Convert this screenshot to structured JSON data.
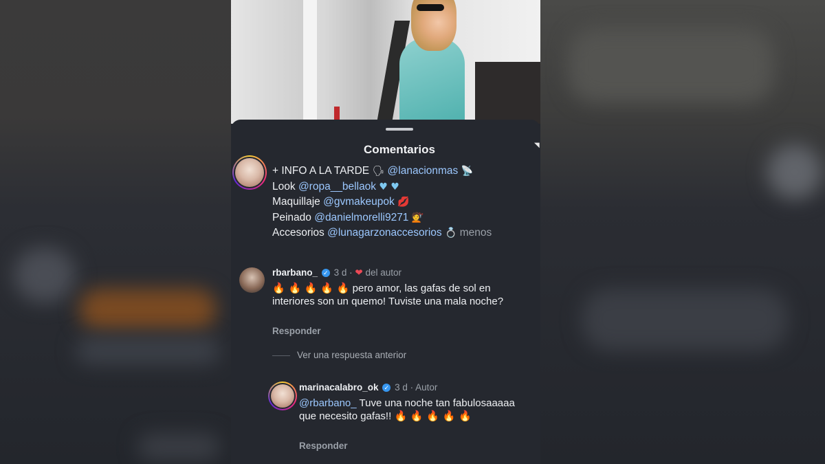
{
  "sheet": {
    "title": "Comentarios"
  },
  "caption": {
    "line1_text": "+ INFO A LA TARDE",
    "line1_mention": "@lanacionmas",
    "line2_text": "Look",
    "line2_mention": "@ropa__bellaok",
    "line3_text": "Maquillaje",
    "line3_mention": "@gvmakeupok",
    "line4_text": "Peinado",
    "line4_mention": "@danielmorelli9271",
    "line5_text": "Accesorios",
    "line5_mention": "@lunagarzonaccesorios",
    "less_label": "menos"
  },
  "comment1": {
    "username": "rbarbano_",
    "time": "3 d",
    "liked_by": "del autor",
    "fire": "🔥 🔥 🔥 🔥 🔥",
    "body": "pero amor, las gafas de sol en interiores son un quemo! Tuviste una mala noche?",
    "reply_label": "Responder"
  },
  "view_previous": "Ver una respuesta anterior",
  "comment2": {
    "username": "marinacalabro_ok",
    "time": "3 d",
    "tag": "Autor",
    "mention": "@rbarbano_",
    "body": "Tuve una noche tan fabulosaaaaa que necesito gafas!!",
    "fire": "🔥 🔥 🔥 🔥 🔥",
    "reply_label": "Responder"
  },
  "icons": {
    "verified": "verified-badge-icon",
    "heart": "heart-icon"
  },
  "colors": {
    "sheet_bg": "#25282f",
    "mention": "#9cc8ff",
    "verified": "#3797f0",
    "heart": "#ed4956"
  }
}
